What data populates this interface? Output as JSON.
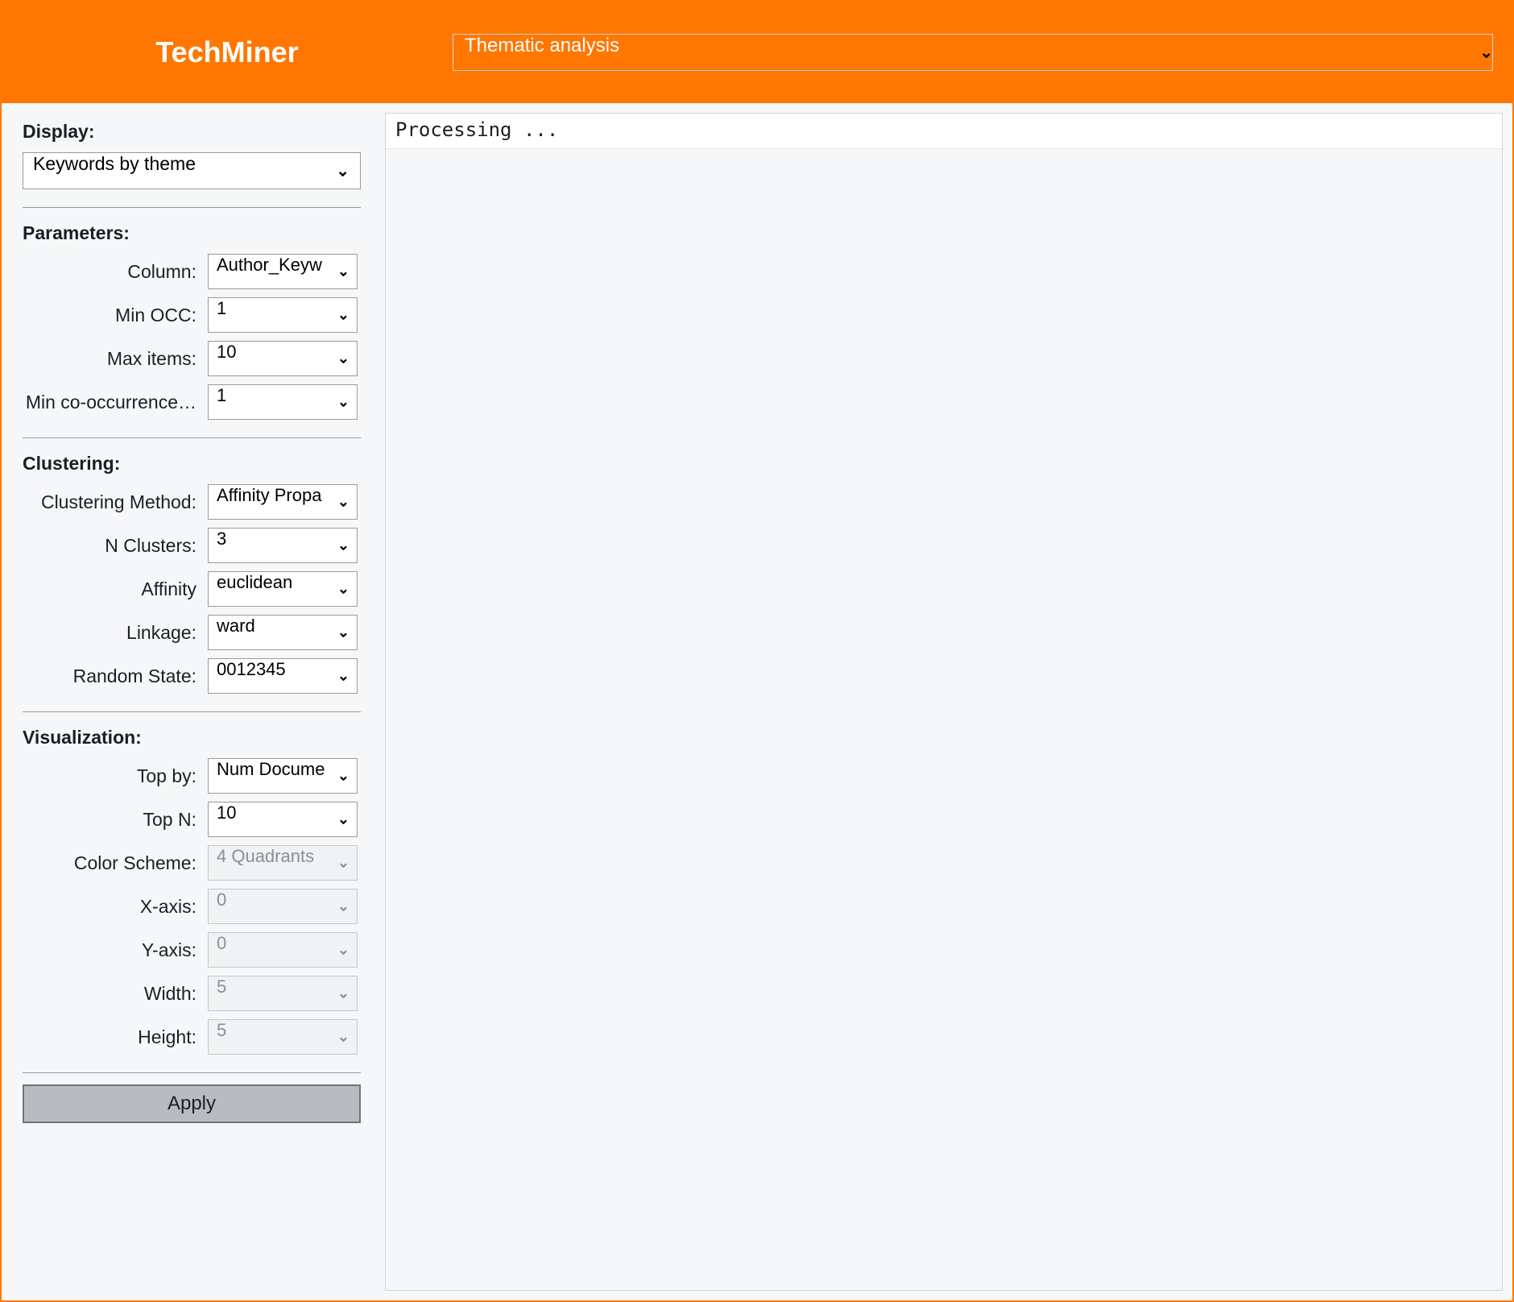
{
  "header": {
    "title": "TechMiner",
    "analysis_select": "Thematic analysis"
  },
  "sidebar": {
    "display": {
      "heading": "Display:",
      "value": "Keywords by theme"
    },
    "parameters": {
      "heading": "Parameters:",
      "rows": [
        {
          "label": "Column:",
          "value": "Author_Keyw",
          "disabled": false
        },
        {
          "label": "Min OCC:",
          "value": "1",
          "disabled": false
        },
        {
          "label": "Max items:",
          "value": "10",
          "disabled": false
        },
        {
          "label": "Min co-occurrence…",
          "value": "1",
          "disabled": false
        }
      ]
    },
    "clustering": {
      "heading": "Clustering:",
      "rows": [
        {
          "label": "Clustering Method:",
          "value": "Affinity Propa",
          "disabled": false
        },
        {
          "label": "N Clusters:",
          "value": "3",
          "disabled": false
        },
        {
          "label": "Affinity",
          "value": "euclidean",
          "disabled": false
        },
        {
          "label": "Linkage:",
          "value": "ward",
          "disabled": false
        },
        {
          "label": "Random State:",
          "value": "0012345",
          "disabled": false
        }
      ]
    },
    "visualization": {
      "heading": "Visualization:",
      "rows": [
        {
          "label": "Top by:",
          "value": "Num Docume",
          "disabled": false
        },
        {
          "label": "Top N:",
          "value": "10",
          "disabled": false
        },
        {
          "label": "Color Scheme:",
          "value": "4 Quadrants",
          "disabled": true
        },
        {
          "label": "X-axis:",
          "value": "0",
          "disabled": true
        },
        {
          "label": "Y-axis:",
          "value": "0",
          "disabled": true
        },
        {
          "label": "Width:",
          "value": "5",
          "disabled": true
        },
        {
          "label": "Height:",
          "value": "5",
          "disabled": true
        }
      ]
    },
    "apply_label": "Apply"
  },
  "output": {
    "status_text": "Processing ..."
  }
}
